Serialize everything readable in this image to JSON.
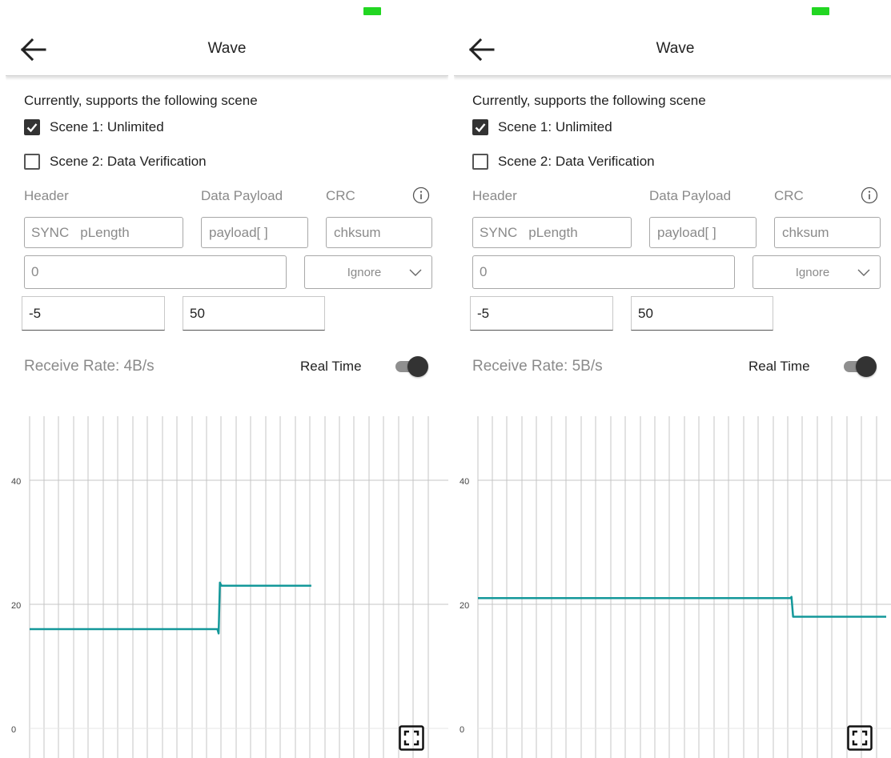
{
  "colors": {
    "battery": "#22d622",
    "line": "#14989a",
    "grid": "#c4c4c4",
    "muted_text": "#8a8a8a",
    "toggle_thumb": "#333333"
  },
  "icons": [
    "arrow-left-icon",
    "checkmark-icon",
    "info-icon",
    "chevron-down-icon",
    "fullscreen-icon"
  ],
  "screens": [
    {
      "app_bar": {
        "title": "Wave"
      },
      "intro_text": "Currently, supports the following scene",
      "scene1": {
        "label": "Scene 1: Unlimited",
        "checked": true
      },
      "scene2": {
        "label": "Scene 2: Data Verification",
        "checked": false
      },
      "labels": {
        "header": "Header",
        "payload": "Data Payload",
        "crc": "CRC"
      },
      "placeholders": {
        "sync": "SYNC",
        "plength": "pLength",
        "payload": "payload[ ]",
        "crc": "chksum",
        "value": "0"
      },
      "select": {
        "value": "Ignore"
      },
      "range": {
        "min": "-5",
        "max": "50"
      },
      "receive_rate": "Receive Rate: 4B/s",
      "real_time": {
        "label": "Real Time",
        "enabled": true
      },
      "chart_data": {
        "type": "line",
        "ylim": [
          0,
          50
        ],
        "y_ticks": [
          "40",
          "20",
          "0"
        ],
        "grid": true,
        "series": [
          {
            "points": [
              [
                0,
                16
              ],
              [
                0.46,
                16
              ],
              [
                0.463,
                15.3
              ],
              [
                0.466,
                23.5
              ],
              [
                0.47,
                23
              ],
              [
                0.69,
                23
              ]
            ]
          }
        ]
      }
    },
    {
      "app_bar": {
        "title": "Wave"
      },
      "intro_text": "Currently, supports the following scene",
      "scene1": {
        "label": "Scene 1: Unlimited",
        "checked": true
      },
      "scene2": {
        "label": "Scene 2: Data Verification",
        "checked": false
      },
      "labels": {
        "header": "Header",
        "payload": "Data Payload",
        "crc": "CRC"
      },
      "placeholders": {
        "sync": "SYNC",
        "plength": "pLength",
        "payload": "payload[ ]",
        "crc": "chksum",
        "value": "0"
      },
      "select": {
        "value": "Ignore"
      },
      "range": {
        "min": "-5",
        "max": "50"
      },
      "receive_rate": "Receive Rate: 5B/s",
      "real_time": {
        "label": "Real Time",
        "enabled": true
      },
      "chart_data": {
        "type": "line",
        "ylim": [
          0,
          50
        ],
        "y_ticks": [
          "40",
          "20",
          "0"
        ],
        "grid": true,
        "series": [
          {
            "points": [
              [
                0,
                21
              ],
              [
                0.765,
                21
              ],
              [
                0.768,
                21.2
              ],
              [
                0.772,
                18
              ],
              [
                0.775,
                18
              ],
              [
                1,
                18
              ]
            ]
          }
        ]
      }
    }
  ]
}
